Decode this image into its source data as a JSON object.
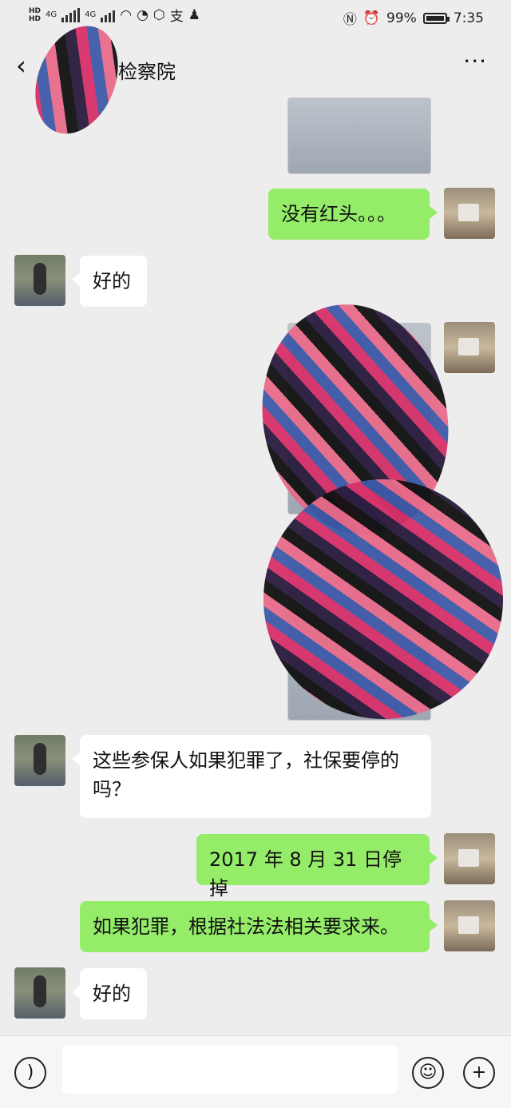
{
  "status_bar": {
    "left_badges": [
      "HD",
      "HD"
    ],
    "network": "4G",
    "network2": "4G",
    "extra_icons": [
      "wifi-icon",
      "clock-icon",
      "shield-icon",
      "alipay-icon",
      "qq-icon"
    ],
    "battery_percent": "99%",
    "time": "7:35"
  },
  "nav": {
    "back": "‹",
    "title": "检察院",
    "more": "···"
  },
  "messages": [
    {
      "side": "out",
      "type": "text",
      "text": "没有红头。。。"
    },
    {
      "side": "in",
      "type": "text",
      "text": "好的"
    },
    {
      "side": "in",
      "type": "text",
      "text": "这些参保人如果犯罪了，社保要停的吗？"
    },
    {
      "side": "out",
      "type": "text",
      "text": "2017 年 8 月 31 日停掉"
    },
    {
      "side": "out",
      "type": "text",
      "text": "如果犯罪，根据社法法相关要求来。"
    },
    {
      "side": "in",
      "type": "text",
      "text": "好的"
    }
  ],
  "composer": {
    "voice_icon": "voice-icon",
    "emoji_icon": "emoji-icon",
    "plus_icon": "plus-icon"
  }
}
